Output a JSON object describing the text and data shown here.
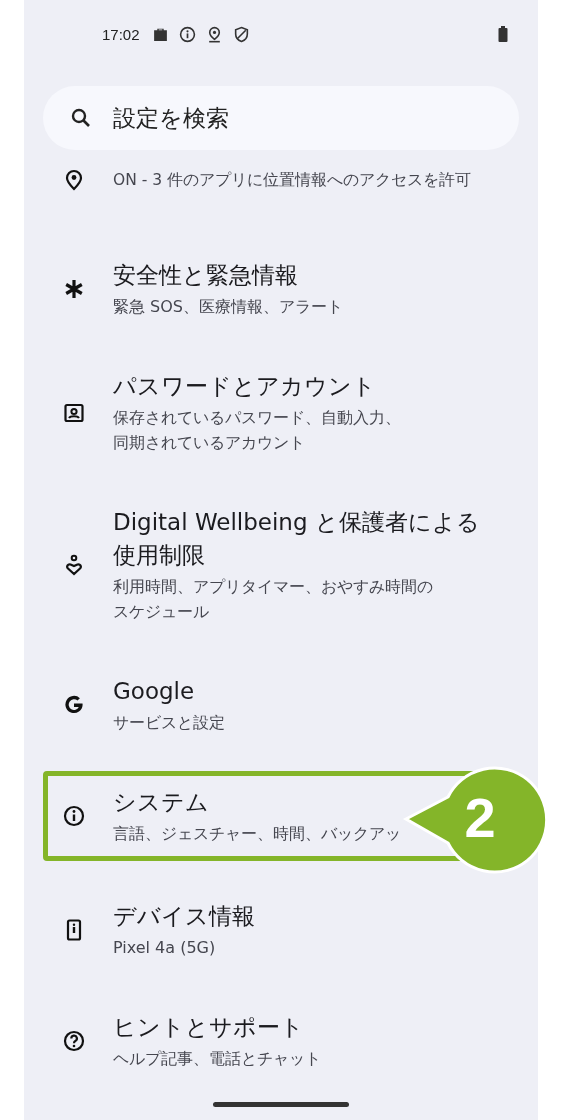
{
  "status_bar": {
    "time": "17:02"
  },
  "search": {
    "placeholder": "設定を検索"
  },
  "items": [
    {
      "kind": "location",
      "subtitle": "ON - 3 件のアプリに位置情報へのアクセスを許可",
      "highlighted": false
    },
    {
      "kind": "safety",
      "title": "安全性と緊急情報",
      "subtitle": "緊急 SOS、医療情報、アラート",
      "highlighted": false
    },
    {
      "kind": "account",
      "title": "パスワードとアカウント",
      "subtitle": "保存されているパスワード、自動入力、同期されているアカウント",
      "highlighted": false
    },
    {
      "kind": "wellbeing",
      "title": "Digital Wellbeing と保護者による使用制限",
      "subtitle": "利用時間、アプリタイマー、おやすみ時間のスケジュール",
      "highlighted": false
    },
    {
      "kind": "google",
      "title": "Google",
      "subtitle": "サービスと設定",
      "highlighted": false
    },
    {
      "kind": "system",
      "title": "システム",
      "subtitle": "言語、ジェスチャー、時間、バックアッ",
      "highlighted": true
    },
    {
      "kind": "device",
      "title": "デバイス情報",
      "subtitle": "Pixel 4a (5G)",
      "highlighted": false
    },
    {
      "kind": "help",
      "title": "ヒントとサポート",
      "subtitle": "ヘルプ記事、電話とチャット",
      "highlighted": false
    }
  ],
  "callout": {
    "number": "2"
  }
}
